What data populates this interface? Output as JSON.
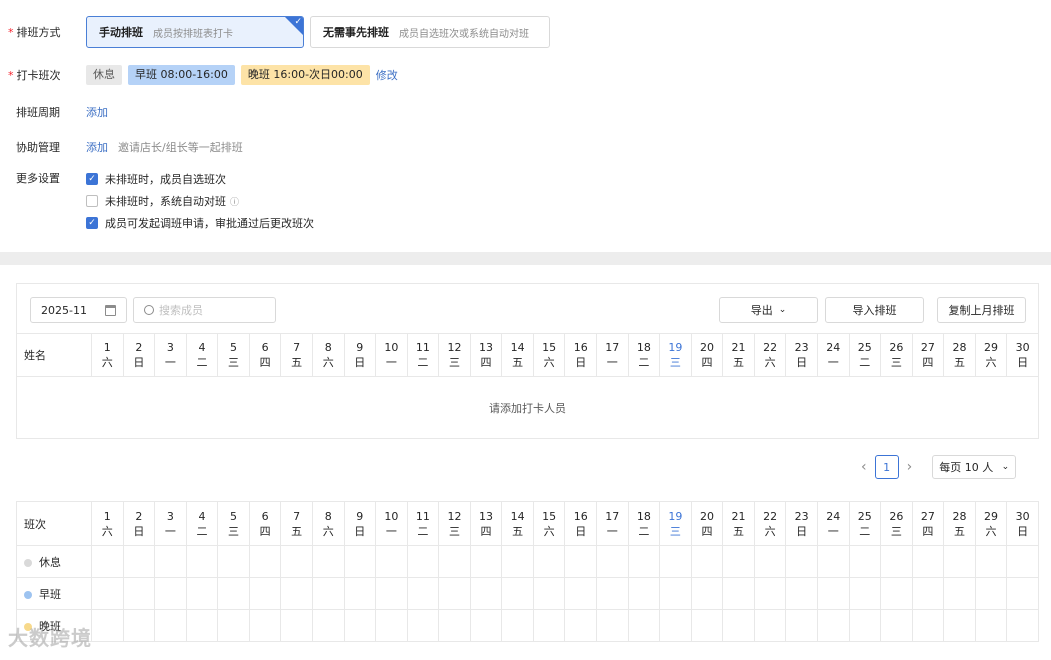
{
  "settings": {
    "schedule_mode": {
      "label": "排班方式",
      "options": [
        {
          "title": "手动排班",
          "desc": "成员按排班表打卡",
          "selected": true
        },
        {
          "title": "无需事先排班",
          "desc": "成员自选班次或系统自动对班",
          "selected": false
        }
      ]
    },
    "shifts": {
      "label": "打卡班次",
      "tags": [
        {
          "text": "休息",
          "color": "#e8e8e8"
        },
        {
          "text": "早班 08:00-16:00",
          "color": "#b5d2f7"
        },
        {
          "text": "晚班 16:00-次日00:00",
          "color": "#fde3a7"
        }
      ],
      "edit": "修改"
    },
    "cycle": {
      "label": "排班周期",
      "add": "添加"
    },
    "assist": {
      "label": "协助管理",
      "add": "添加",
      "hint": "邀请店长/组长等一起排班"
    },
    "more": {
      "label": "更多设置",
      "items": [
        {
          "text": "未排班时，成员自选班次",
          "checked": true
        },
        {
          "text": "未排班时，系统自动对班",
          "checked": false,
          "info": "ⓘ"
        },
        {
          "text": "成员可发起调班申请，审批通过后更改班次",
          "checked": true
        }
      ]
    }
  },
  "toolbar": {
    "month": "2025-11",
    "search_placeholder": "搜索成员",
    "export": "导出",
    "import": "导入排班",
    "copy": "复制上月排班"
  },
  "member_table": {
    "name_header": "姓名",
    "empty_text": "请添加打卡人员"
  },
  "days": [
    {
      "n": "1",
      "w": "六"
    },
    {
      "n": "2",
      "w": "日"
    },
    {
      "n": "3",
      "w": "一"
    },
    {
      "n": "4",
      "w": "二"
    },
    {
      "n": "5",
      "w": "三"
    },
    {
      "n": "6",
      "w": "四"
    },
    {
      "n": "7",
      "w": "五"
    },
    {
      "n": "8",
      "w": "六"
    },
    {
      "n": "9",
      "w": "日"
    },
    {
      "n": "10",
      "w": "一"
    },
    {
      "n": "11",
      "w": "二"
    },
    {
      "n": "12",
      "w": "三"
    },
    {
      "n": "13",
      "w": "四"
    },
    {
      "n": "14",
      "w": "五"
    },
    {
      "n": "15",
      "w": "六"
    },
    {
      "n": "16",
      "w": "日"
    },
    {
      "n": "17",
      "w": "一"
    },
    {
      "n": "18",
      "w": "二"
    },
    {
      "n": "19",
      "w": "三",
      "today": true
    },
    {
      "n": "20",
      "w": "四"
    },
    {
      "n": "21",
      "w": "五"
    },
    {
      "n": "22",
      "w": "六"
    },
    {
      "n": "23",
      "w": "日"
    },
    {
      "n": "24",
      "w": "一"
    },
    {
      "n": "25",
      "w": "二"
    },
    {
      "n": "26",
      "w": "三"
    },
    {
      "n": "27",
      "w": "四"
    },
    {
      "n": "28",
      "w": "五"
    },
    {
      "n": "29",
      "w": "六"
    },
    {
      "n": "30",
      "w": "日"
    }
  ],
  "pagination": {
    "prev": "‹",
    "page": "1",
    "next": "›",
    "page_size": "每页 10 人"
  },
  "shift_table": {
    "header": "班次",
    "rows": [
      {
        "name": "休息",
        "color": "#d9d9d9"
      },
      {
        "name": "早班",
        "color": "#9dc3f0"
      },
      {
        "name": "晚班",
        "color": "#f7d98b"
      }
    ]
  },
  "watermark": "大数跨境"
}
